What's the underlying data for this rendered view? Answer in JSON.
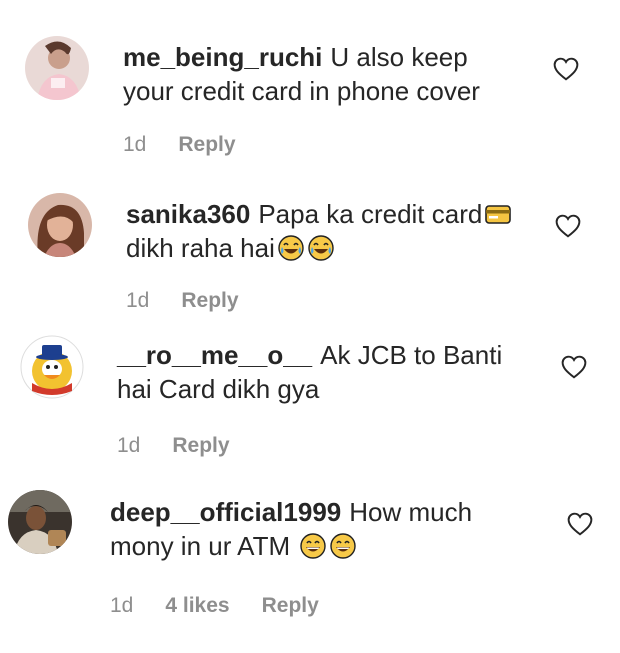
{
  "comments": [
    {
      "username": "me_being_ruchi",
      "text": "U also keep your credit card in phone cover",
      "time": "1d",
      "reply_label": "Reply"
    },
    {
      "username": "sanika360",
      "text_before": "Papa ka credit card",
      "text_after": "dikh raha hai",
      "time": "1d",
      "reply_label": "Reply"
    },
    {
      "username": "__ro__me__o__",
      "text": "Ak JCB to Banti hai Card dikh gya",
      "time": "1d",
      "reply_label": "Reply"
    },
    {
      "username": "deep__official1999",
      "text": "How much mony in ur ATM",
      "time": "1d",
      "likes": "4 likes",
      "reply_label": "Reply"
    }
  ],
  "icons": {
    "like": "heart-outline-icon",
    "credit_card_emoji": "credit-card-icon",
    "laughing_emoji": "face-with-tears-of-joy-icon",
    "grinning_emoji": "grinning-face-icon"
  }
}
